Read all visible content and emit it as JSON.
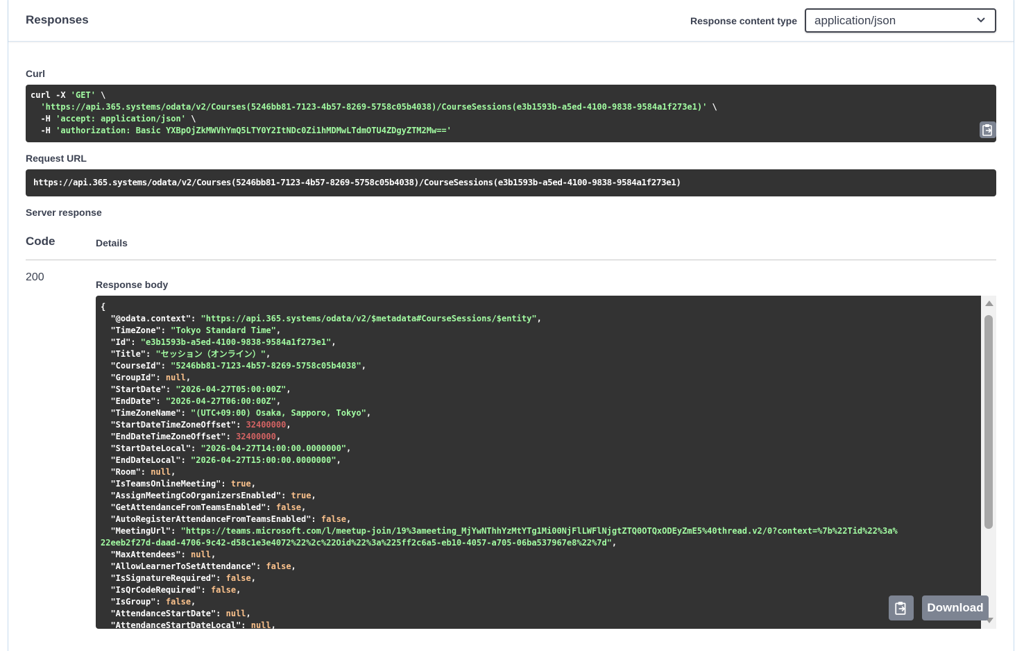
{
  "header": {
    "title": "Responses",
    "content_type_label": "Response content type",
    "content_type_value": "application/json"
  },
  "curl": {
    "label": "Curl",
    "lines": [
      [
        {
          "t": "curl -X ",
          "c": "white"
        },
        {
          "t": "'GET'",
          "c": "green"
        },
        {
          "t": " \\",
          "c": "white"
        }
      ],
      [
        {
          "t": "  ",
          "c": "white"
        },
        {
          "t": "'https://api.365.systems/odata/v2/Courses(5246bb81-7123-4b57-8269-5758c05b4038)/CourseSessions(e3b1593b-a5ed-4100-9838-9584a1f273e1)'",
          "c": "green"
        },
        {
          "t": " \\",
          "c": "white"
        }
      ],
      [
        {
          "t": "  -H ",
          "c": "white"
        },
        {
          "t": "'accept: application/json'",
          "c": "green"
        },
        {
          "t": " \\",
          "c": "white"
        }
      ],
      [
        {
          "t": "  -H ",
          "c": "white"
        },
        {
          "t": "'authorization: Basic YXBpOjZkMWVhYmQ5LTY0Y2ItNDc0Zi1hMDMwLTdmOTU4ZDgyZTM2Mw=='",
          "c": "green"
        }
      ]
    ]
  },
  "request_url": {
    "label": "Request URL",
    "value": "https://api.365.systems/odata/v2/Courses(5246bb81-7123-4b57-8269-5758c05b4038)/CourseSessions(e3b1593b-a5ed-4100-9838-9584a1f273e1)"
  },
  "server_response": {
    "label": "Server response",
    "code_header": "Code",
    "details_header": "Details",
    "code": "200",
    "body_label": "Response body",
    "download_label": "Download",
    "body_lines": [
      [
        {
          "t": "{",
          "c": "white"
        }
      ],
      [
        {
          "t": "  \"@odata.context\": ",
          "c": "white"
        },
        {
          "t": "\"https://api.365.systems/odata/v2/$metadata#CourseSessions/$entity\"",
          "c": "green"
        },
        {
          "t": ",",
          "c": "white"
        }
      ],
      [
        {
          "t": "  \"TimeZone\": ",
          "c": "white"
        },
        {
          "t": "\"Tokyo Standard Time\"",
          "c": "green"
        },
        {
          "t": ",",
          "c": "white"
        }
      ],
      [
        {
          "t": "  \"Id\": ",
          "c": "white"
        },
        {
          "t": "\"e3b1593b-a5ed-4100-9838-9584a1f273e1\"",
          "c": "green"
        },
        {
          "t": ",",
          "c": "white"
        }
      ],
      [
        {
          "t": "  \"Title\": ",
          "c": "white"
        },
        {
          "t": "\"セッション（オンライン）\"",
          "c": "green"
        },
        {
          "t": ",",
          "c": "white"
        }
      ],
      [
        {
          "t": "  \"CourseId\": ",
          "c": "white"
        },
        {
          "t": "\"5246bb81-7123-4b57-8269-5758c05b4038\"",
          "c": "green"
        },
        {
          "t": ",",
          "c": "white"
        }
      ],
      [
        {
          "t": "  \"GroupId\": ",
          "c": "white"
        },
        {
          "t": "null",
          "c": "orange"
        },
        {
          "t": ",",
          "c": "white"
        }
      ],
      [
        {
          "t": "  \"StartDate\": ",
          "c": "white"
        },
        {
          "t": "\"2026-04-27T05:00:00Z\"",
          "c": "green"
        },
        {
          "t": ",",
          "c": "white"
        }
      ],
      [
        {
          "t": "  \"EndDate\": ",
          "c": "white"
        },
        {
          "t": "\"2026-04-27T06:00:00Z\"",
          "c": "green"
        },
        {
          "t": ",",
          "c": "white"
        }
      ],
      [
        {
          "t": "  \"TimeZoneName\": ",
          "c": "white"
        },
        {
          "t": "\"(UTC+09:00) Osaka, Sapporo, Tokyo\"",
          "c": "green"
        },
        {
          "t": ",",
          "c": "white"
        }
      ],
      [
        {
          "t": "  \"StartDateTimeZoneOffset\": ",
          "c": "white"
        },
        {
          "t": "32400000",
          "c": "red"
        },
        {
          "t": ",",
          "c": "white"
        }
      ],
      [
        {
          "t": "  \"EndDateTimeZoneOffset\": ",
          "c": "white"
        },
        {
          "t": "32400000",
          "c": "red"
        },
        {
          "t": ",",
          "c": "white"
        }
      ],
      [
        {
          "t": "  \"StartDateLocal\": ",
          "c": "white"
        },
        {
          "t": "\"2026-04-27T14:00:00.0000000\"",
          "c": "green"
        },
        {
          "t": ",",
          "c": "white"
        }
      ],
      [
        {
          "t": "  \"EndDateLocal\": ",
          "c": "white"
        },
        {
          "t": "\"2026-04-27T15:00:00.0000000\"",
          "c": "green"
        },
        {
          "t": ",",
          "c": "white"
        }
      ],
      [
        {
          "t": "  \"Room\": ",
          "c": "white"
        },
        {
          "t": "null",
          "c": "orange"
        },
        {
          "t": ",",
          "c": "white"
        }
      ],
      [
        {
          "t": "  \"IsTeamsOnlineMeeting\": ",
          "c": "white"
        },
        {
          "t": "true",
          "c": "orange"
        },
        {
          "t": ",",
          "c": "white"
        }
      ],
      [
        {
          "t": "  \"AssignMeetingCoOrganizersEnabled\": ",
          "c": "white"
        },
        {
          "t": "true",
          "c": "orange"
        },
        {
          "t": ",",
          "c": "white"
        }
      ],
      [
        {
          "t": "  \"GetAttendanceFromTeamsEnabled\": ",
          "c": "white"
        },
        {
          "t": "false",
          "c": "orange"
        },
        {
          "t": ",",
          "c": "white"
        }
      ],
      [
        {
          "t": "  \"AutoRegisterAttendanceFromTeamsEnabled\": ",
          "c": "white"
        },
        {
          "t": "false",
          "c": "orange"
        },
        {
          "t": ",",
          "c": "white"
        }
      ],
      [
        {
          "t": "  \"MeetingUrl\": ",
          "c": "white"
        },
        {
          "t": "\"https://teams.microsoft.com/l/meetup-join/19%3ameeting_MjYwNThhYzMtYTg1Mi00NjFlLWFlNjgtZTQ0OTQxODEyZmE5%40thread.v2/0?context=%7b%22Tid%22%3a%",
          "c": "green"
        }
      ],
      [
        {
          "t": "22eeb2f27d-daad-4706-9c42-d58c1e3e4072%22%2c%22Oid%22%3a%225ff2c6a5-eb10-4057-a705-06ba537967e8%22%7d\"",
          "c": "green"
        },
        {
          "t": ",",
          "c": "white"
        }
      ],
      [
        {
          "t": "  \"MaxAttendees\": ",
          "c": "white"
        },
        {
          "t": "null",
          "c": "orange"
        },
        {
          "t": ",",
          "c": "white"
        }
      ],
      [
        {
          "t": "  \"AllowLearnerToSetAttendance\": ",
          "c": "white"
        },
        {
          "t": "false",
          "c": "orange"
        },
        {
          "t": ",",
          "c": "white"
        }
      ],
      [
        {
          "t": "  \"IsSignatureRequired\": ",
          "c": "white"
        },
        {
          "t": "false",
          "c": "orange"
        },
        {
          "t": ",",
          "c": "white"
        }
      ],
      [
        {
          "t": "  \"IsQrCodeRequired\": ",
          "c": "white"
        },
        {
          "t": "false",
          "c": "orange"
        },
        {
          "t": ",",
          "c": "white"
        }
      ],
      [
        {
          "t": "  \"IsGroup\": ",
          "c": "white"
        },
        {
          "t": "false",
          "c": "orange"
        },
        {
          "t": ",",
          "c": "white"
        }
      ],
      [
        {
          "t": "  \"AttendanceStartDate\": ",
          "c": "white"
        },
        {
          "t": "null",
          "c": "orange"
        },
        {
          "t": ",",
          "c": "white"
        }
      ],
      [
        {
          "t": "  \"AttendanceStartDateLocal\": ",
          "c": "white"
        },
        {
          "t": "null",
          "c": "orange"
        },
        {
          "t": ",",
          "c": "white"
        }
      ]
    ]
  },
  "icons": {
    "chevron": "chevron-down-icon",
    "copy": "clipboard-copy-icon"
  }
}
